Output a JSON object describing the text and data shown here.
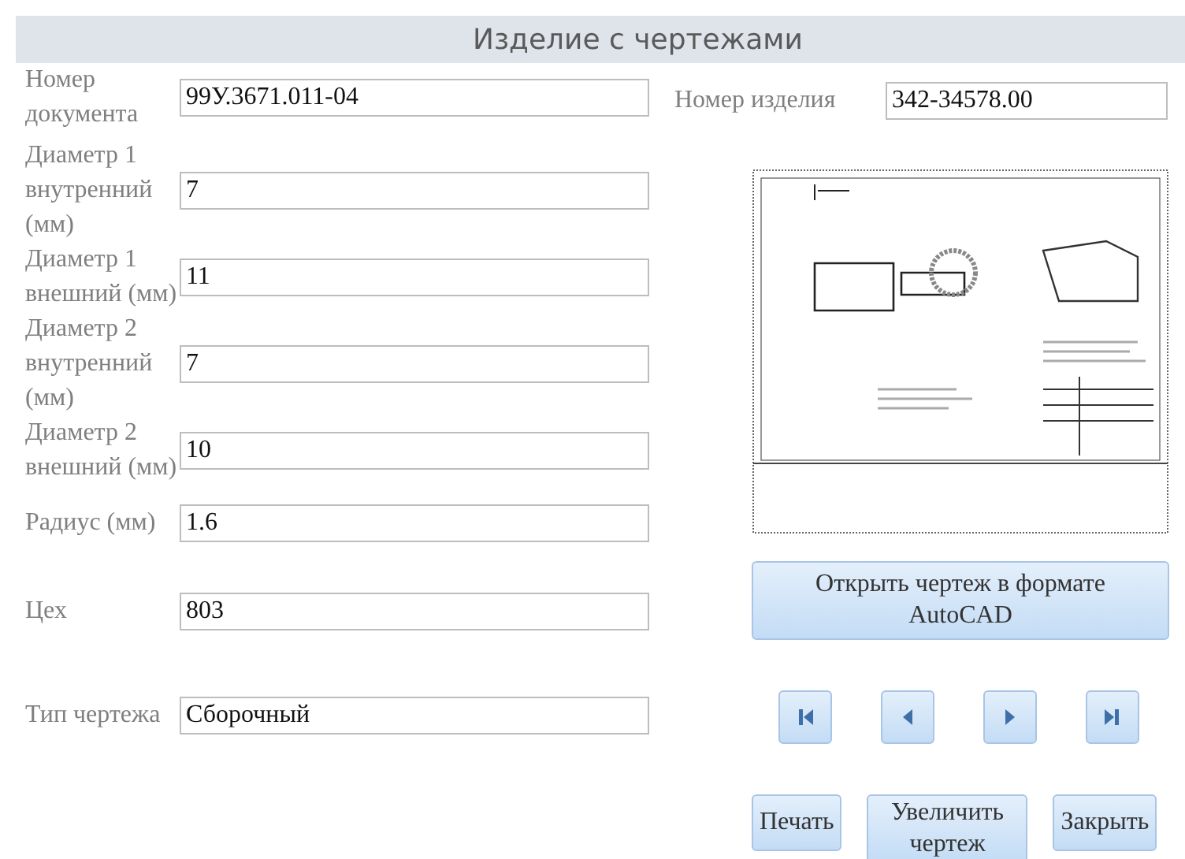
{
  "form": {
    "title": "Изделие с чертежами"
  },
  "fields": [
    {
      "label": "Номер документа",
      "value": "99У.3671.011-04"
    },
    {
      "label": "Диаметр 1 внутренний (мм)",
      "value": "7"
    },
    {
      "label": "Диаметр 1 внешний (мм)",
      "value": "11"
    },
    {
      "label": "Диаметр 2 внутренний (мм)",
      "value": "7"
    },
    {
      "label": "Диаметр 2 внешний (мм)",
      "value": "10"
    },
    {
      "label": "Радиус (мм)",
      "value": "1.6"
    },
    {
      "label": "Цех",
      "value": "803"
    },
    {
      "label": "Тип чертежа",
      "value": "Сборочный"
    }
  ],
  "product_field": {
    "label": "Номер изделия",
    "value": "342-34578.00"
  },
  "drawing_preview": {
    "kind": "picture"
  },
  "open_button": "Открыть чертеж в формате AutoCAD",
  "navigation": [
    {
      "kind": "first"
    },
    {
      "kind": "prev"
    },
    {
      "kind": "next"
    },
    {
      "kind": "last"
    }
  ],
  "buttons": [
    "Печать",
    "Увеличить чертеж",
    "Закрыть"
  ]
}
